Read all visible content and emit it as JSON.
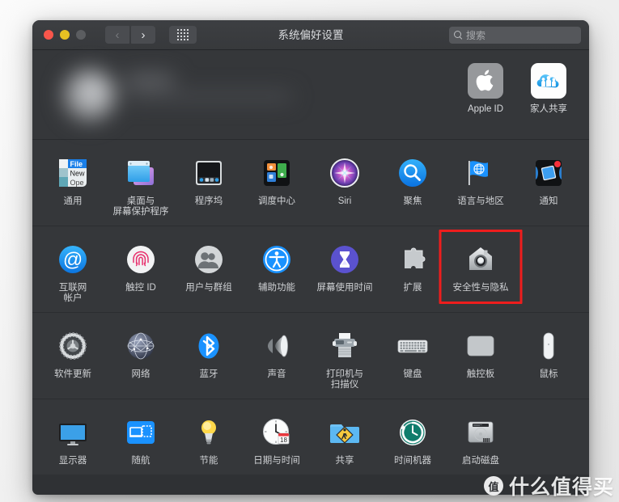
{
  "window": {
    "title": "系统偏好设置",
    "traffic_lights": [
      "close",
      "minimize",
      "zoom"
    ],
    "back_label": "‹",
    "forward_label": "›",
    "grid_label": "show-all"
  },
  "search": {
    "placeholder": "搜索",
    "value": ""
  },
  "account_banner": {
    "blurred": true,
    "top_items": [
      {
        "label": "Apple ID",
        "icon": "apple-id-icon"
      },
      {
        "label": "家人共享",
        "icon": "family-sharing-icon"
      }
    ]
  },
  "sections": [
    {
      "name": "personal",
      "items": [
        {
          "label": "通用",
          "icon": "general-icon"
        },
        {
          "label": "桌面与\n屏幕保护程序",
          "icon": "desktop-screensaver-icon"
        },
        {
          "label": "程序坞",
          "icon": "dock-icon"
        },
        {
          "label": "调度中心",
          "icon": "mission-control-icon"
        },
        {
          "label": "Siri",
          "icon": "siri-icon"
        },
        {
          "label": "聚焦",
          "icon": "spotlight-icon"
        },
        {
          "label": "语言与地区",
          "icon": "language-region-icon"
        },
        {
          "label": "通知",
          "icon": "notifications-icon"
        }
      ]
    },
    {
      "name": "accounts",
      "items": [
        {
          "label": "互联网\n帐户",
          "icon": "internet-accounts-icon"
        },
        {
          "label": "触控 ID",
          "icon": "touch-id-icon"
        },
        {
          "label": "用户与群组",
          "icon": "users-groups-icon"
        },
        {
          "label": "辅助功能",
          "icon": "accessibility-icon"
        },
        {
          "label": "屏幕使用时间",
          "icon": "screen-time-icon"
        },
        {
          "label": "扩展",
          "icon": "extensions-icon"
        },
        {
          "label": "安全性与隐私",
          "icon": "security-privacy-icon",
          "highlighted": true
        }
      ]
    },
    {
      "name": "hardware",
      "items": [
        {
          "label": "软件更新",
          "icon": "software-update-icon"
        },
        {
          "label": "网络",
          "icon": "network-icon"
        },
        {
          "label": "蓝牙",
          "icon": "bluetooth-icon"
        },
        {
          "label": "声音",
          "icon": "sound-icon"
        },
        {
          "label": "打印机与\n扫描仪",
          "icon": "printers-scanners-icon"
        },
        {
          "label": "键盘",
          "icon": "keyboard-icon"
        },
        {
          "label": "触控板",
          "icon": "trackpad-icon"
        },
        {
          "label": "鼠标",
          "icon": "mouse-icon"
        }
      ]
    },
    {
      "name": "system",
      "items": [
        {
          "label": "显示器",
          "icon": "displays-icon"
        },
        {
          "label": "随航",
          "icon": "sidecar-icon"
        },
        {
          "label": "节能",
          "icon": "energy-saver-icon"
        },
        {
          "label": "日期与时间",
          "icon": "date-time-icon"
        },
        {
          "label": "共享",
          "icon": "sharing-icon"
        },
        {
          "label": "时间机器",
          "icon": "time-machine-icon"
        },
        {
          "label": "启动磁盘",
          "icon": "startup-disk-icon"
        }
      ]
    }
  ],
  "watermark": {
    "badge": "值",
    "text": "什么值得买"
  },
  "colors": {
    "window_bg": "#35373a",
    "titlebar_bg": "#3a3c3f",
    "highlight": "#ee1d1d",
    "accent_blue": "#1a92ff",
    "label": "#cfd1d4"
  }
}
